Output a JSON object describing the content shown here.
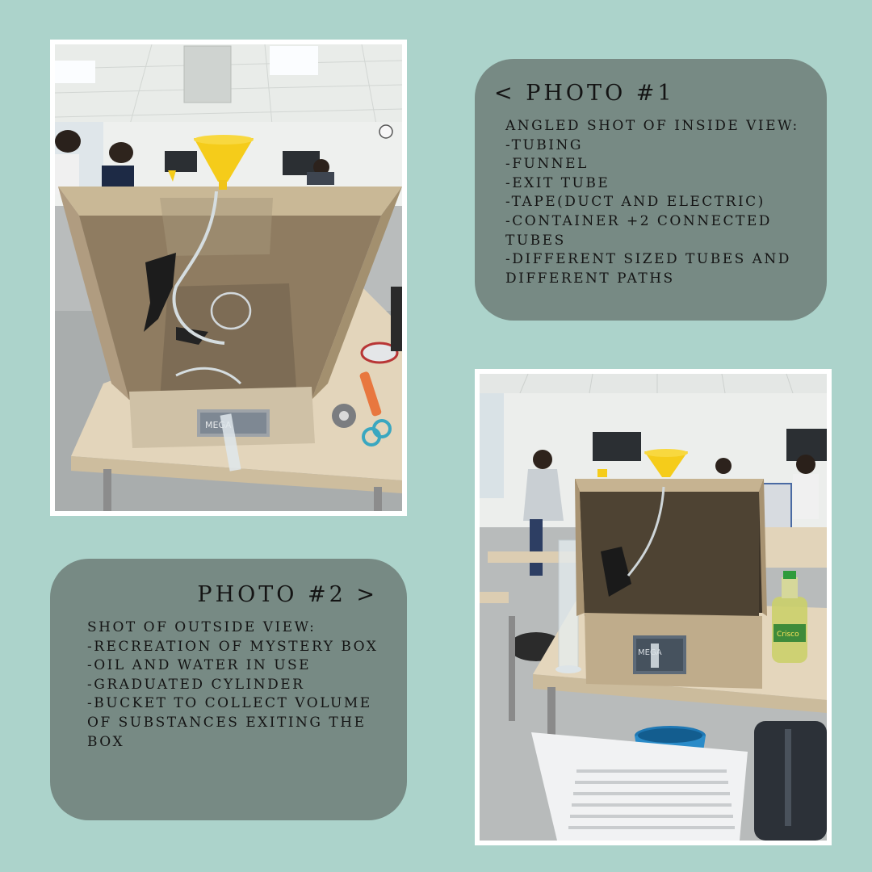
{
  "photo1": {
    "description_label": "photo-1-mystery-box-inside",
    "box_label": "MEGA"
  },
  "photo2": {
    "description_label": "photo-2-mystery-box-outside",
    "box_label": "MEGA",
    "bottle_label": "Crisco"
  },
  "card1": {
    "title": "< PHOTO #1",
    "heading": "ANGLED SHOT OF INSIDE VIEW:",
    "items": [
      "-TUBING",
      "-FUNNEL",
      "-EXIT TUBE",
      "-TAPE(DUCT AND ELECTRIC)",
      "-CONTAINER +2 CONNECTED TUBES",
      "-DIFFERENT SIZED TUBES AND DIFFERENT PATHS"
    ]
  },
  "card2": {
    "title": "PHOTO #2 >",
    "heading": "SHOT OF OUTSIDE VIEW:",
    "items": [
      "-RECREATION OF MYSTERY BOX",
      "-OIL AND WATER IN USE",
      "-GRADUATED CYLINDER",
      "-BUCKET TO COLLECT VOLUME OF SUBSTANCES EXITING THE BOX"
    ]
  },
  "colors": {
    "background": "#acd3cb",
    "card": "#778a84",
    "frame": "#ffffff",
    "funnel": "#f5cc1a",
    "cardboard": "#b7a386"
  }
}
